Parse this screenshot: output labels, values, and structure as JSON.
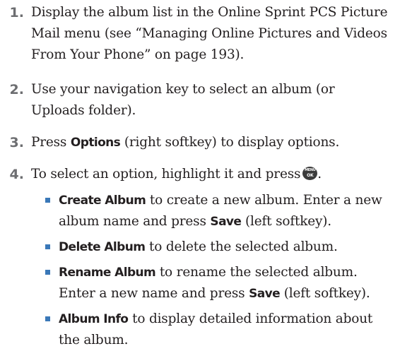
{
  "steps": [
    {
      "number": "1.",
      "line1": "Display the album list in the Online Sprint PCS Picture",
      "line2": "Mail menu (see “Managing Online Pictures and Videos",
      "line3": "From Your Phone” on page 193)."
    },
    {
      "number": "2.",
      "line1": "Use your navigation key to select an album (or",
      "line2": "Uploads folder)."
    },
    {
      "number": "3.",
      "before": "Press ",
      "keyword": "Options",
      "after": " (right softkey) to display options."
    },
    {
      "number": "4.",
      "before": "To select an option, highlight it and press",
      "after": "."
    }
  ],
  "menu_key": {
    "icon": "menu-ok-key-icon",
    "top_text": "MENU",
    "bottom_text": "OK"
  },
  "options": [
    {
      "name": "Create Album",
      "line1": " to create a new album. Enter a new",
      "line2_before": "album name and press ",
      "line2_keyword": "Save",
      "line2_after": " (left softkey)."
    },
    {
      "name": "Delete Album",
      "line1": " to delete the selected album."
    },
    {
      "name": "Rename Album",
      "line1": " to rename the selected album.",
      "line2_before": "Enter a new name and press ",
      "line2_keyword": "Save",
      "line2_after": " (left softkey)."
    },
    {
      "name": "Album Info",
      "line1": " to display detailed information about",
      "line2": "the album."
    }
  ],
  "colors": {
    "step_number": "#6d6e71",
    "bullet": "#3a78b8",
    "text": "#231f20"
  }
}
